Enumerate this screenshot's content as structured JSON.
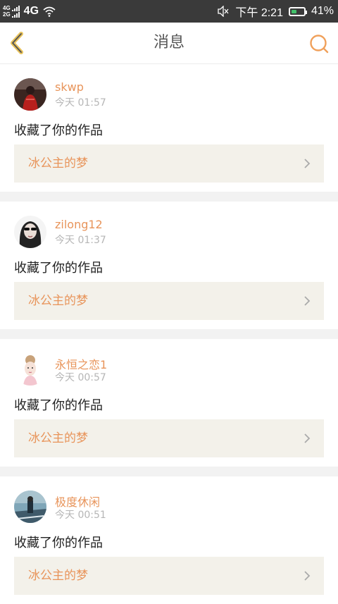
{
  "status_bar": {
    "sig1": "4G",
    "sig2": "2G",
    "network": "4G",
    "time": "下午 2:21",
    "battery": "41%",
    "icons": [
      "signal-icon",
      "wifi-icon",
      "mute-icon",
      "battery-icon"
    ]
  },
  "header": {
    "title": "消息",
    "icons": [
      "back-arrow-icon",
      "search-icon"
    ],
    "accent_color": "#f0a05a"
  },
  "messages": [
    {
      "user": "skwp",
      "time": "今天 01:57",
      "action": "收藏了你的作品",
      "work": "冰公主的梦"
    },
    {
      "user": "zilong12",
      "time": "今天 01:37",
      "action": "收藏了你的作品",
      "work": "冰公主的梦"
    },
    {
      "user": "永恒之恋1",
      "time": "今天 00:57",
      "action": "收藏了你的作品",
      "work": "冰公主的梦"
    },
    {
      "user": "极度休闲",
      "time": "今天 00:51",
      "action": "收藏了你的作品",
      "work": "冰公主的梦"
    }
  ],
  "colors": {
    "username": "#e8945a",
    "timestamp": "#b6b6b6",
    "work_bg": "#f3f1ea",
    "divider": "#f2f2f2",
    "status_bg": "#3a3a3a"
  }
}
